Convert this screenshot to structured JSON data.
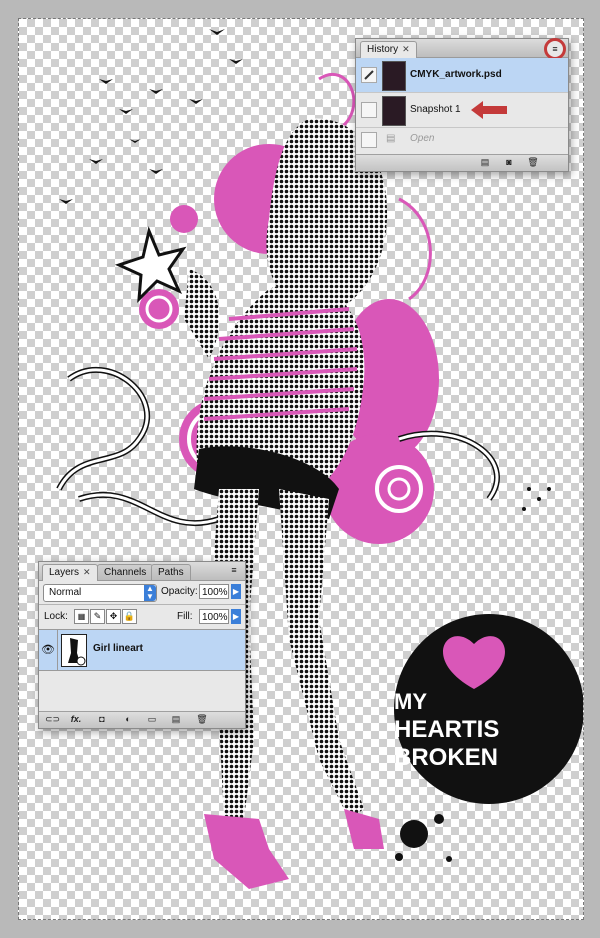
{
  "colors": {
    "accent": "#d957b8",
    "selection": "#bcd6f4",
    "highlight": "#c43a3a"
  },
  "history": {
    "tab_label": "History",
    "close_glyph": "✕",
    "menu_glyph": "≡",
    "items": [
      {
        "label": "CMYK_artwork.psd",
        "selected": true
      },
      {
        "label": "Snapshot 1",
        "selected": false
      }
    ],
    "open_label": "Open"
  },
  "layers": {
    "tabs": [
      "Layers",
      "Channels",
      "Paths"
    ],
    "close_glyph": "✕",
    "menu_glyph": "≡",
    "blend_mode": "Normal",
    "opacity_label": "Opacity:",
    "opacity_value": "100%",
    "lock_label": "Lock:",
    "fill_label": "Fill:",
    "fill_value": "100%",
    "layer_name": "Girl lineart",
    "footer_fx": "fx."
  },
  "artwork": {
    "badge_lines": [
      "MY",
      "HEARTIS",
      "BROKEN"
    ]
  }
}
